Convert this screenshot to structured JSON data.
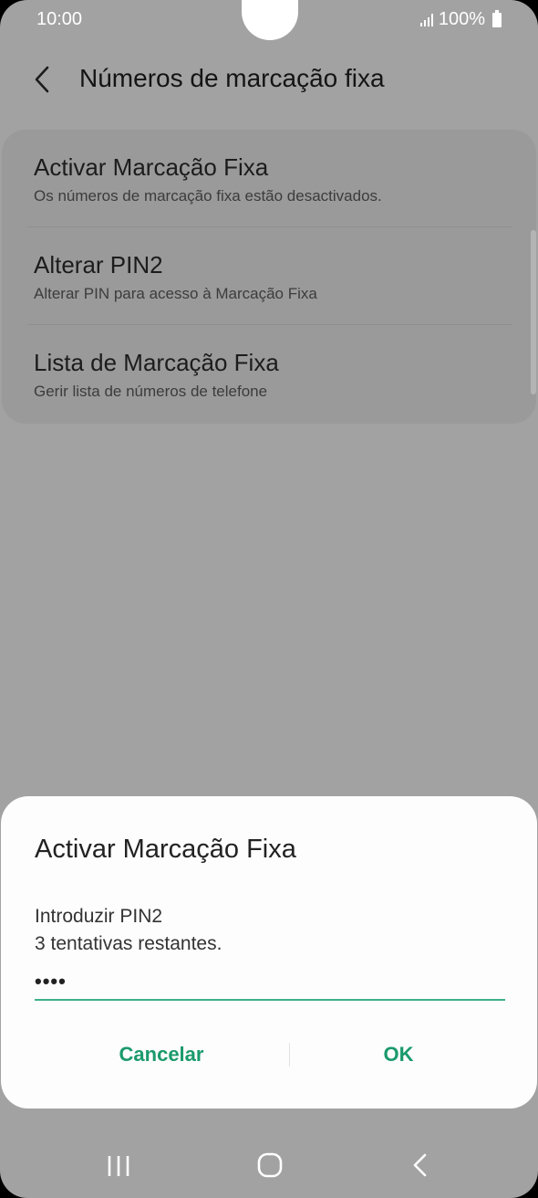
{
  "status_bar": {
    "time": "10:00",
    "battery": "100%"
  },
  "header": {
    "title": "Números de marcação fixa",
    "back_icon": "chevron-left-icon"
  },
  "settings": {
    "items": [
      {
        "title": "Activar Marcação Fixa",
        "subtitle": "Os números de marcação fixa estão desactivados."
      },
      {
        "title": "Alterar PIN2",
        "subtitle": "Alterar PIN para acesso à Marcação Fixa"
      },
      {
        "title": "Lista de Marcação Fixa",
        "subtitle": "Gerir lista de números de telefone"
      }
    ]
  },
  "dialog": {
    "title": "Activar Marcação Fixa",
    "label": "Introduzir PIN2",
    "attempts": "3 tentativas restantes.",
    "pin_value": "••••",
    "cancel_label": "Cancelar",
    "ok_label": "OK"
  },
  "colors": {
    "accent": "#1a9a6c",
    "underline": "#3db08a",
    "background": "#a2a2a2"
  },
  "nav_bar": {
    "icons": [
      "recents-icon",
      "home-icon",
      "back-icon"
    ]
  }
}
